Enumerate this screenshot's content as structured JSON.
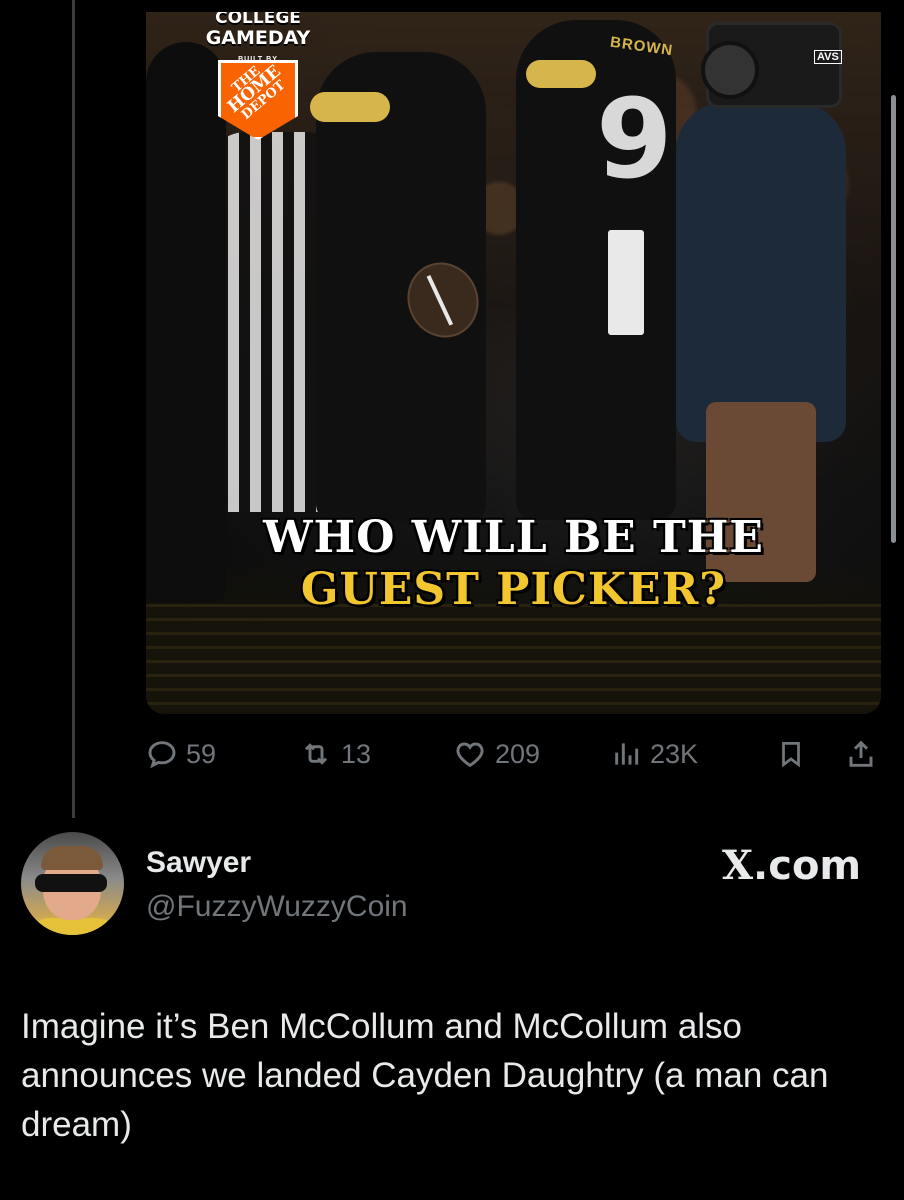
{
  "media": {
    "badge": {
      "line1": "COLLEGE",
      "line2": "GAMEDAY",
      "built_by": "BUILT BY",
      "sponsor_top": "THE",
      "sponsor_mid": "HOME",
      "sponsor_bottom": "DEPOT"
    },
    "jersey_name": "BROWN",
    "jersey_number": "9",
    "camera_brand": "AVS",
    "headline_line1": "WHO WILL BE THE",
    "headline_line2": "GUEST PICKER?",
    "colors": {
      "gold": "#f2c62f",
      "orange": "#f96302"
    }
  },
  "actions": {
    "reply_count": "59",
    "repost_count": "13",
    "like_count": "209",
    "view_count": "23K",
    "icons": [
      "reply-icon",
      "repost-icon",
      "like-icon",
      "views-icon",
      "bookmark-icon",
      "share-icon"
    ]
  },
  "quote": {
    "display_name": "Sawyer",
    "handle": "@FuzzyWuzzyCoin",
    "source_x": "X",
    "source_suffix": ".com",
    "text": "Imagine it’s Ben McCollum and McCollum also announces we landed Cayden Daughtry (a man can dream)"
  }
}
